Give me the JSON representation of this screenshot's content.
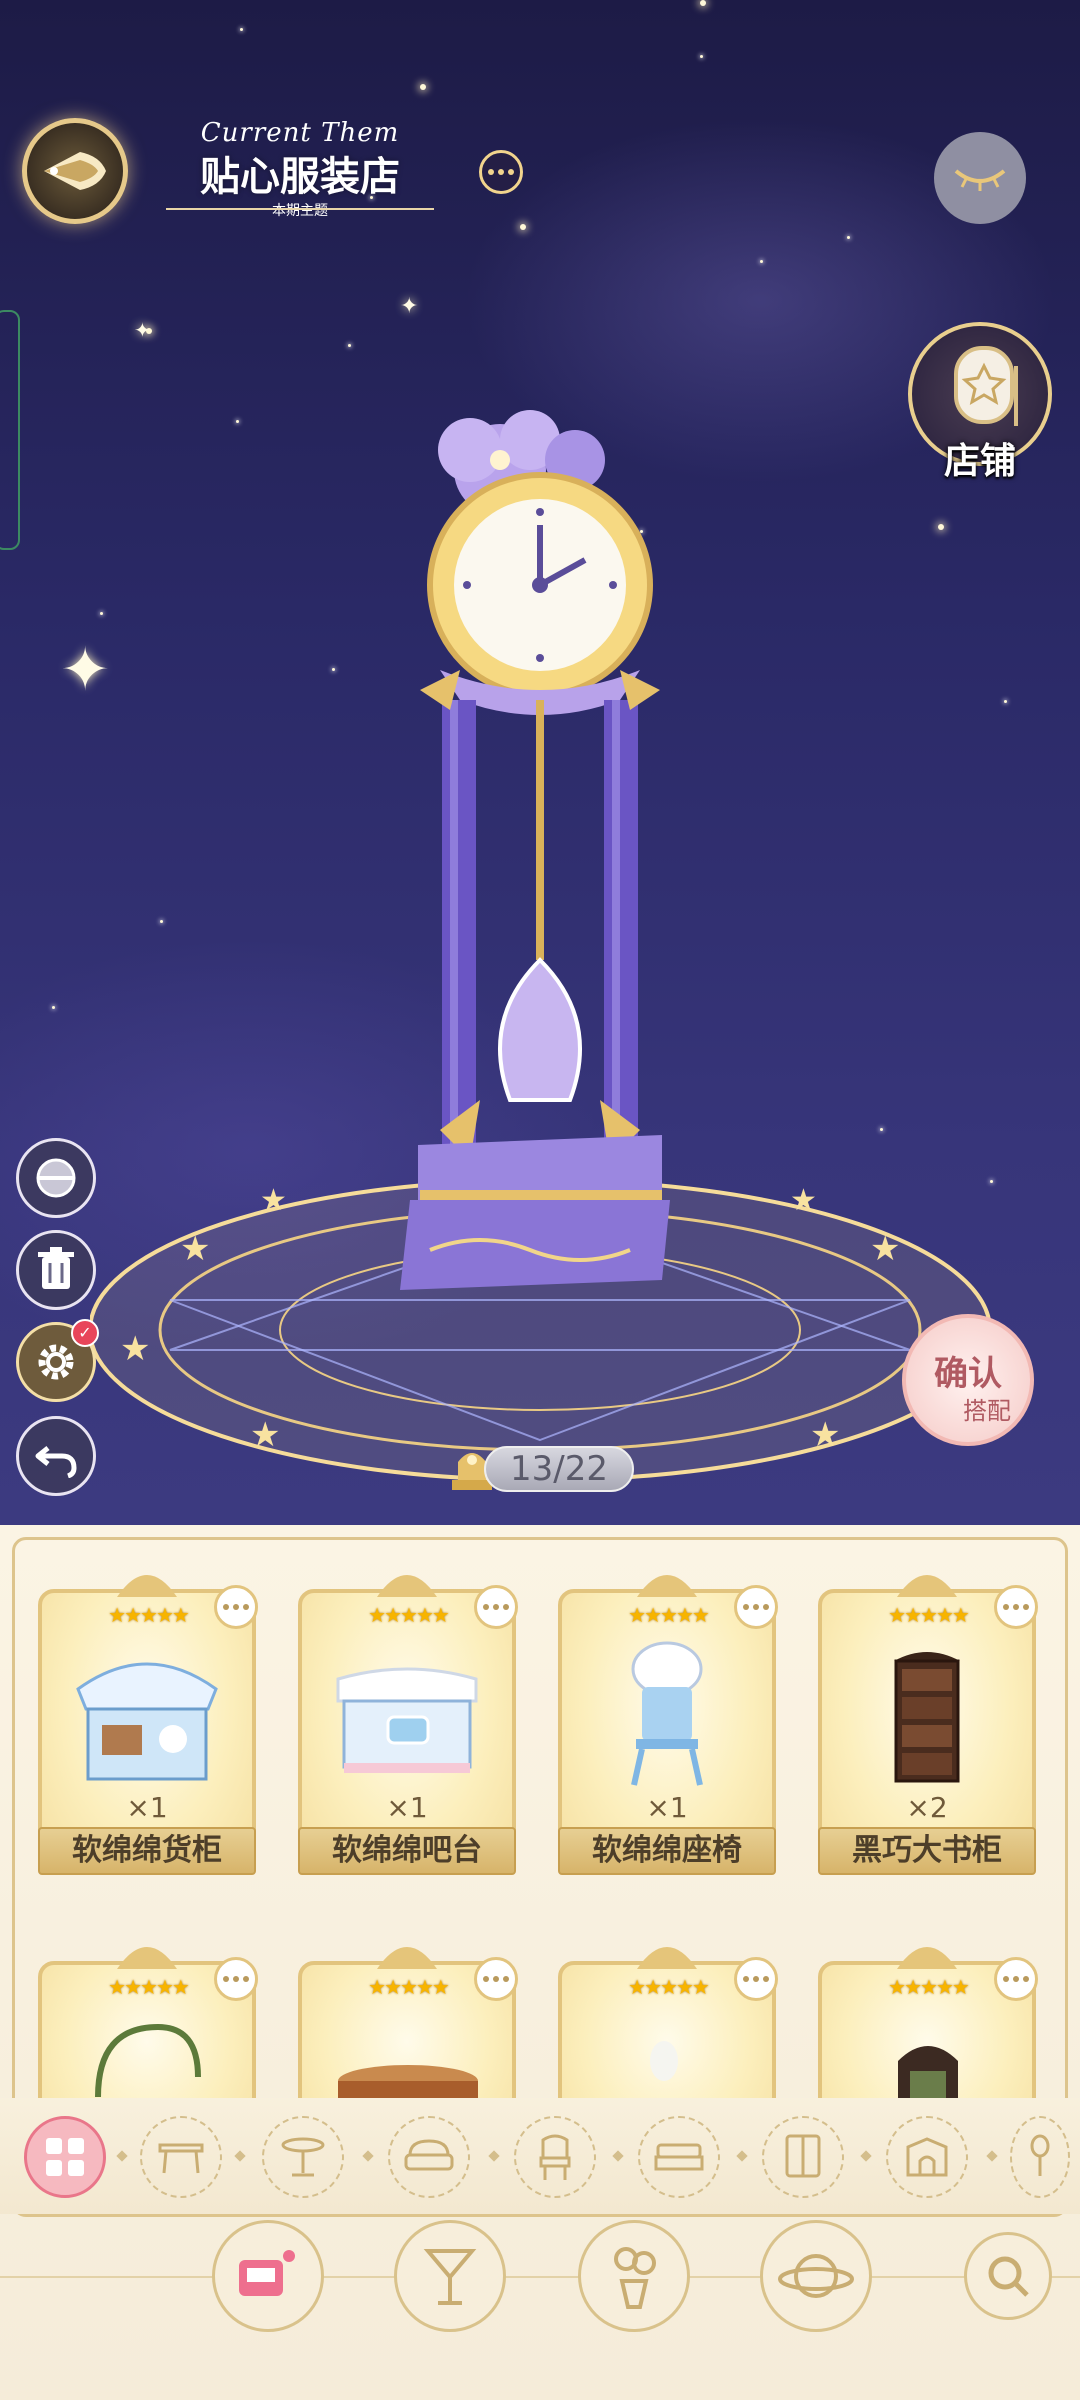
{
  "header": {
    "theme_label_en": "Current Them",
    "theme_title": "贴心服装店",
    "theme_sub": "本期主题"
  },
  "store": {
    "label": "店铺"
  },
  "confirm": {
    "main": "确认",
    "sub": "搭配"
  },
  "counter": {
    "text": "13/22"
  },
  "items_row1": [
    {
      "name": "软绵绵货柜",
      "qty": "×1",
      "stars": "★★★★★"
    },
    {
      "name": "软绵绵吧台",
      "qty": "×1",
      "stars": "★★★★★"
    },
    {
      "name": "软绵绵座椅",
      "qty": "×1",
      "stars": "★★★★★"
    },
    {
      "name": "黑巧大书柜",
      "qty": "×2",
      "stars": "★★★★★"
    }
  ],
  "items_row2": [
    {
      "stars": "★★★★★"
    },
    {
      "stars": "★★★★★"
    },
    {
      "stars": "★★★★★"
    },
    {
      "stars": "★★★★★"
    }
  ],
  "categories": [
    "all-icon",
    "table-icon",
    "round-table-icon",
    "sofa-icon",
    "chair-icon",
    "bed-icon",
    "cabinet-icon",
    "fireplace-icon",
    "lamp-icon"
  ],
  "bottom_nav": [
    "furniture-icon",
    "drink-icon",
    "flower-icon",
    "planet-icon",
    "search-icon"
  ],
  "colors": {
    "accent_gold": "#e2c47e",
    "sky": "#2a2966",
    "active_pink": "#f6b9c0"
  }
}
